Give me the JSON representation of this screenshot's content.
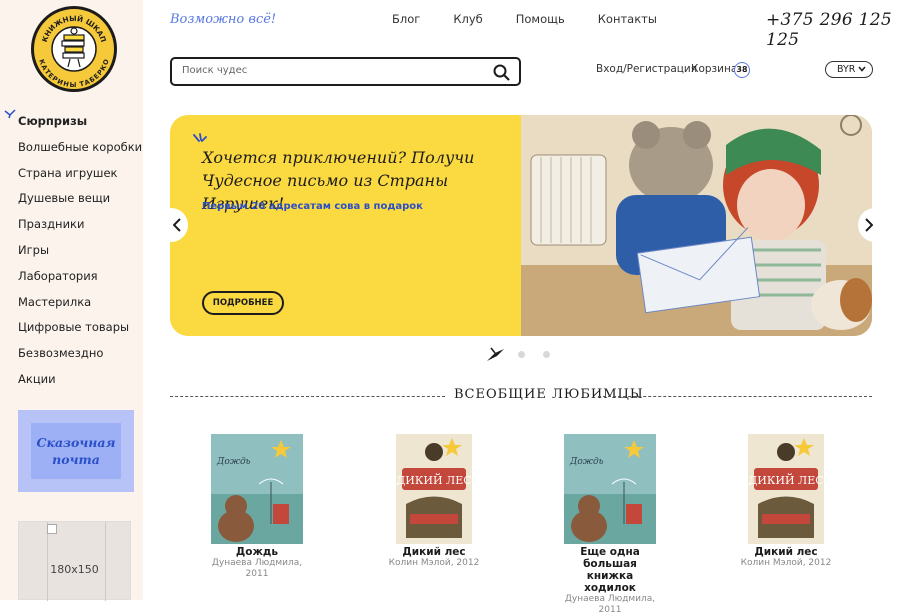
{
  "brand": {
    "logo_text_top": "КНИЖНЫЙ ШКАП",
    "logo_text_bottom": "КАТЕРИНЫ ТАБЕРКО",
    "tagline": "Возможно всё!"
  },
  "header": {
    "nav": [
      "Блог",
      "Клуб",
      "Помощь",
      "Контакты"
    ],
    "phone": "+375 296 125 125",
    "search_placeholder": "Поиск чудес",
    "auth": "Вход/Регистрация",
    "cart_label": "Корзина",
    "cart_count": "38",
    "currency": "BYR"
  },
  "sidebar": {
    "items": [
      {
        "label": "Сюрпризы",
        "active": true
      },
      {
        "label": "Волшебные коробки"
      },
      {
        "label": "Страна игрушек"
      },
      {
        "label": "Душевые вещи"
      },
      {
        "label": "Праздники"
      },
      {
        "label": "Игры"
      },
      {
        "label": "Лаборатория"
      },
      {
        "label": "Мастерилка"
      },
      {
        "label": "Цифровые товары"
      },
      {
        "label": "Безвозмездно"
      },
      {
        "label": "Акции"
      }
    ],
    "stamp_line1": "Сказочная",
    "stamp_line2": "почта",
    "ad_size": "180x150"
  },
  "banner": {
    "title": "Хочется приключений? Получи Чудесное письмо из Страны Игрушек!",
    "subtitle": "Первым 20 адресатам сова в подарок",
    "button": "ПОДРОБНЕЕ",
    "slides": 3,
    "active_slide": 0
  },
  "section": {
    "title": "ВСЕОБЩИЕ ЛЮБИМЦЫ"
  },
  "books": [
    {
      "title": "Дождь",
      "author": "Дунаева Людмила,",
      "year": "2011",
      "cover": "rain"
    },
    {
      "title": "Дикий лес",
      "author": "Колин Мэлой, 2012",
      "year": "",
      "cover": "forest"
    },
    {
      "title": "Еще одна большая книжка ходилок",
      "author": "Дунаева Людмила,",
      "year": "2011",
      "cover": "rain"
    },
    {
      "title": "Дикий лес",
      "author": "Колин Мэлой, 2012",
      "year": "",
      "cover": "forest"
    }
  ],
  "colors": {
    "accent_yellow": "#fbd940",
    "accent_blue": "#5a78e0",
    "sidebar_bg": "#fbf3ec",
    "stamp": "#9db0f5"
  }
}
